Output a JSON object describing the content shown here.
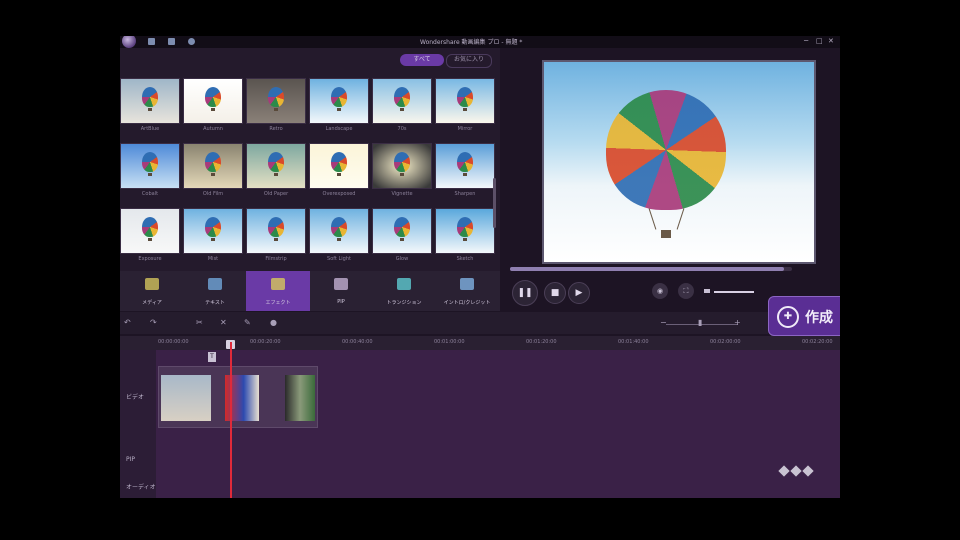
{
  "app": {
    "title": "Wondershare 動画編集 プロ - 無題 *",
    "window_controls": [
      "─",
      "□",
      "✕"
    ],
    "accent": "#6a3aa6"
  },
  "library": {
    "tabs": [
      {
        "label": "すべて",
        "active": true
      },
      {
        "label": "お気に入り",
        "active": false
      }
    ],
    "thumbnails": [
      {
        "label": "ArtBlue"
      },
      {
        "label": "Autumn"
      },
      {
        "label": "Retro"
      },
      {
        "label": "Landscape"
      },
      {
        "label": "70s"
      },
      {
        "label": "Mirror"
      },
      {
        "label": "Cobalt"
      },
      {
        "label": "Old Film"
      },
      {
        "label": "Old Paper"
      },
      {
        "label": "Overexposed"
      },
      {
        "label": "Vignette"
      },
      {
        "label": "Sharpen"
      },
      {
        "label": "Exposure"
      },
      {
        "label": "Mist"
      },
      {
        "label": "Filmstrip"
      },
      {
        "label": "Soft Light"
      },
      {
        "label": "Glow"
      },
      {
        "label": "Sketch"
      }
    ]
  },
  "categories": [
    {
      "label": "メディア",
      "icon": "media-icon",
      "active": false
    },
    {
      "label": "テキスト",
      "icon": "text-icon",
      "active": false
    },
    {
      "label": "エフェクト",
      "icon": "effect-icon",
      "active": true
    },
    {
      "label": "PIP",
      "icon": "pip-icon",
      "active": false
    },
    {
      "label": "トランジション",
      "icon": "transition-icon",
      "active": false
    },
    {
      "label": "イントロ/クレジット",
      "icon": "intro-credit-icon",
      "active": false
    }
  ],
  "preview": {
    "progress": 0.97,
    "controls": {
      "play": "❚❚",
      "stop": "■",
      "next": "▶"
    },
    "snapshot_icon": "camera-icon",
    "fullscreen_icon": "fullscreen-icon"
  },
  "create_button": {
    "label": "作成",
    "icon": "film-reel-icon"
  },
  "timeline": {
    "ruler_ticks": [
      "00:00:00:00",
      "00:00:20:00",
      "00:00:40:00",
      "00:01:00:00",
      "00:01:20:00",
      "00:01:40:00",
      "00:02:00:00",
      "00:02:20:00"
    ],
    "tracks": [
      {
        "label": "ビデオ",
        "icon": "video-track-icon"
      },
      {
        "label": "PIP",
        "icon": "pip-track-icon"
      },
      {
        "label": "オーディオ",
        "icon": "audio-track-icon"
      }
    ],
    "marker_label": "T"
  }
}
